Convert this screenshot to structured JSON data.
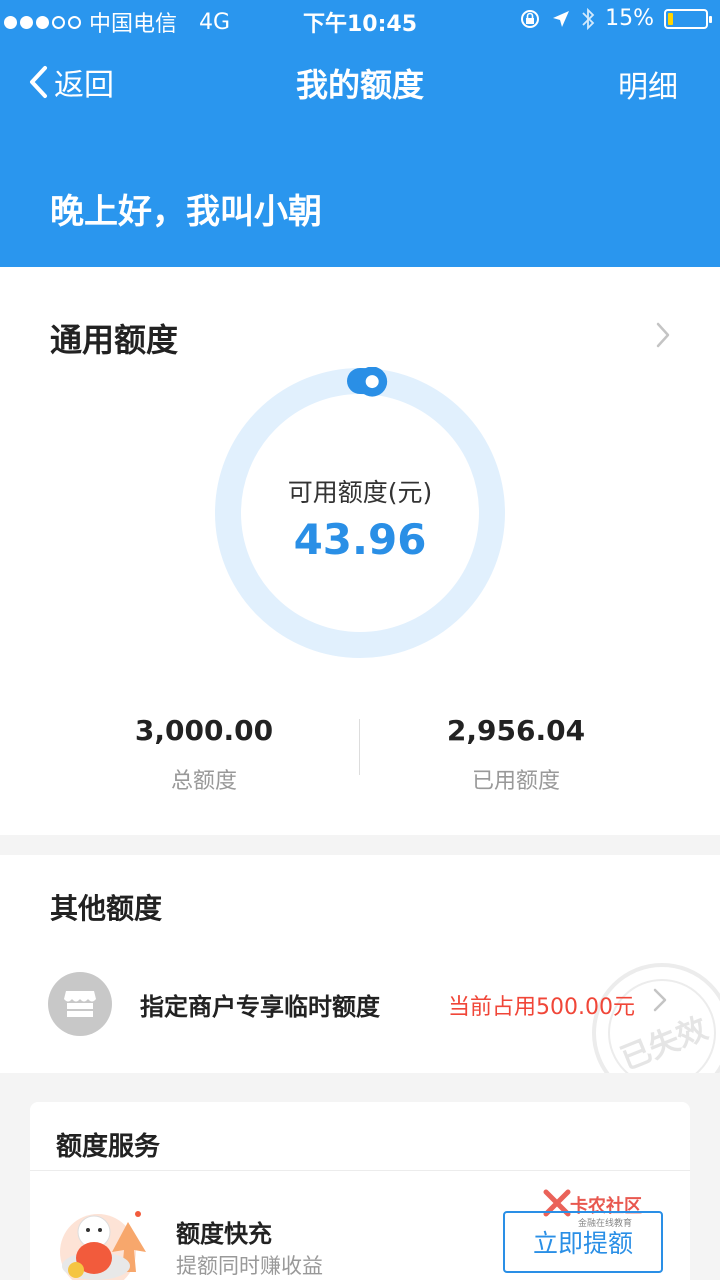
{
  "status_bar": {
    "carrier": "中国电信",
    "network": "4G",
    "time": "下午10:45",
    "battery": "15%",
    "battery_level": 0.15,
    "signal_bars_filled": 3,
    "signal_bars_total": 5
  },
  "nav": {
    "back_label": "返回",
    "title": "我的额度",
    "detail_label": "明细"
  },
  "greeting": "晚上好，我叫小朝",
  "general_quota": {
    "title": "通用额度",
    "available_label": "可用额度(元)",
    "available_value": "43.96",
    "available_fraction": 0.0147,
    "total_value": "3,000.00",
    "total_label": "总额度",
    "used_value": "2,956.04",
    "used_label": "已用额度"
  },
  "other_quota": {
    "title": "其他额度",
    "item_label": "指定商户专享临时额度",
    "item_status": "当前占用500.00元",
    "stamp_text": "已失效"
  },
  "services": {
    "title": "额度服务",
    "item_title": "额度快充",
    "item_subtitle": "提额同时赚收益",
    "button_label": "立即提额",
    "watermark_title": "卡农社区",
    "watermark_subtitle": "金融在线教育"
  },
  "colors": {
    "primary": "#2a96ee",
    "accent_text": "#2a8fe6",
    "warning": "#f04638",
    "ring_track": "#e1f0fd"
  },
  "icons": {
    "back": "chevron-left-icon",
    "arrow": "chevron-right-icon",
    "store": "store-icon",
    "location": "location-arrow-icon",
    "bluetooth": "bluetooth-icon",
    "lock_rotation": "rotation-lock-icon"
  }
}
